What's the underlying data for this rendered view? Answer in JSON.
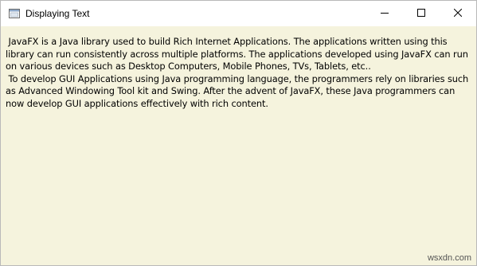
{
  "window": {
    "title": "Displaying Text",
    "icon": "java-app-icon",
    "controls": {
      "minimize_icon": "minimize-icon",
      "maximize_icon": "maximize-icon",
      "close_icon": "close-icon"
    }
  },
  "content": {
    "background_color": "#f5f3dd",
    "paragraph_1": " JavaFX is a Java library used to build Rich Internet Applications. The applications written using this library can run consistently across multiple platforms. The applications developed using JavaFX can run on various devices such as Desktop Computers, Mobile Phones, TVs, Tablets, etc..",
    "paragraph_2": " To develop GUI Applications using Java programming language, the programmers rely on libraries such as Advanced Windowing Tool kit and Swing. After the advent of JavaFX, these Java programmers can now develop GUI applications effectively with rich content."
  },
  "watermark": "wsxdn.com"
}
